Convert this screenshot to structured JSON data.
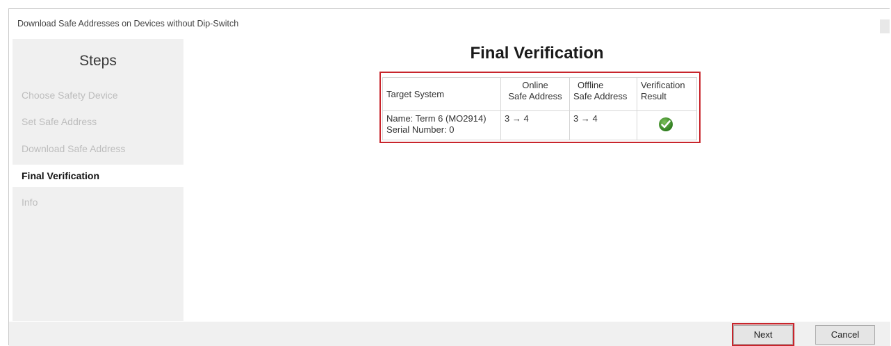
{
  "window": {
    "title": "Download Safe Addresses on Devices without Dip-Switch"
  },
  "sidebar": {
    "title": "Steps",
    "items": [
      {
        "label": "Choose Safety Device",
        "state": "inactive"
      },
      {
        "label": "Set Safe Address",
        "state": "inactive"
      },
      {
        "label": "Download Safe Address",
        "state": "inactive"
      },
      {
        "label": "Final Verification",
        "state": "active"
      },
      {
        "label": "Info",
        "state": "inactive"
      }
    ]
  },
  "main": {
    "title": "Final Verification",
    "table": {
      "headers": {
        "target_system": "Target System",
        "online_line1": "Online",
        "online_line2": "Safe Address",
        "offline_line1": "Offline",
        "offline_line2": "Safe Address",
        "result_line1": "Verification",
        "result_line2": "Result"
      },
      "rows": [
        {
          "name": "Name: Term 6 (MO2914)",
          "serial": "Serial Number: 0",
          "online": "3 → 4",
          "offline": "3 → 4",
          "result_icon": "check-circle-icon"
        }
      ]
    }
  },
  "footer": {
    "next_label": "Next",
    "cancel_label": "Cancel"
  },
  "colors": {
    "highlight": "#c8252c",
    "sidebar_bg": "#f0f0f0",
    "success": "#2f7d1f"
  }
}
